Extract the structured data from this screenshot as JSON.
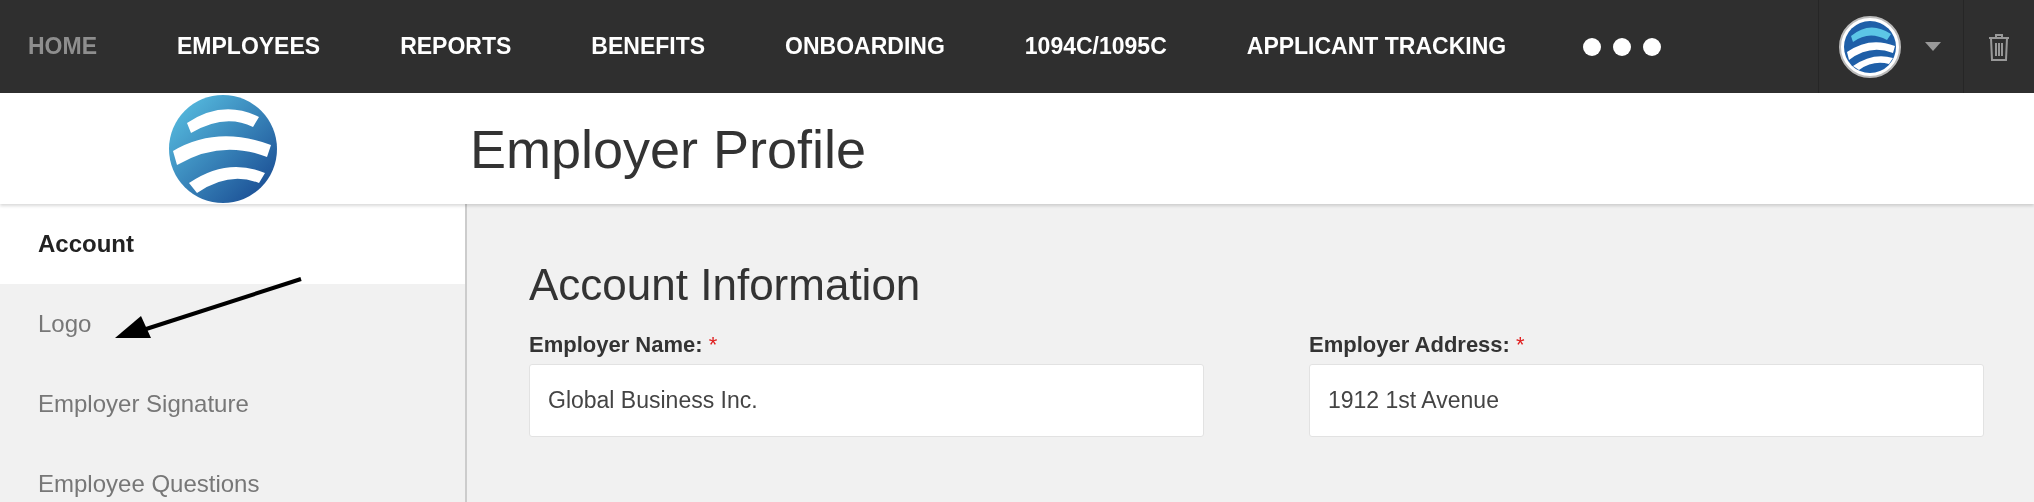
{
  "nav": [
    {
      "label": "HOME",
      "selected": true
    },
    {
      "label": "EMPLOYEES",
      "selected": false
    },
    {
      "label": "REPORTS",
      "selected": false
    },
    {
      "label": "BENEFITS",
      "selected": false
    },
    {
      "label": "ONBOARDING",
      "selected": false
    },
    {
      "label": "1094C/1095C",
      "selected": false
    },
    {
      "label": "APPLICANT TRACKING",
      "selected": false
    }
  ],
  "page_title": "Employer Profile",
  "sidebar": {
    "items": [
      {
        "label": "Account",
        "selected": true
      },
      {
        "label": "Logo",
        "selected": false
      },
      {
        "label": "Employer Signature",
        "selected": false
      },
      {
        "label": "Employee Questions",
        "selected": false
      }
    ]
  },
  "section_title": "Account Information",
  "fields": [
    {
      "label": "Employer Name:",
      "required": true,
      "value": "Global Business Inc."
    },
    {
      "label": "Employer Address:",
      "required": true,
      "value": "1912 1st Avenue"
    }
  ],
  "required_mark": "*"
}
